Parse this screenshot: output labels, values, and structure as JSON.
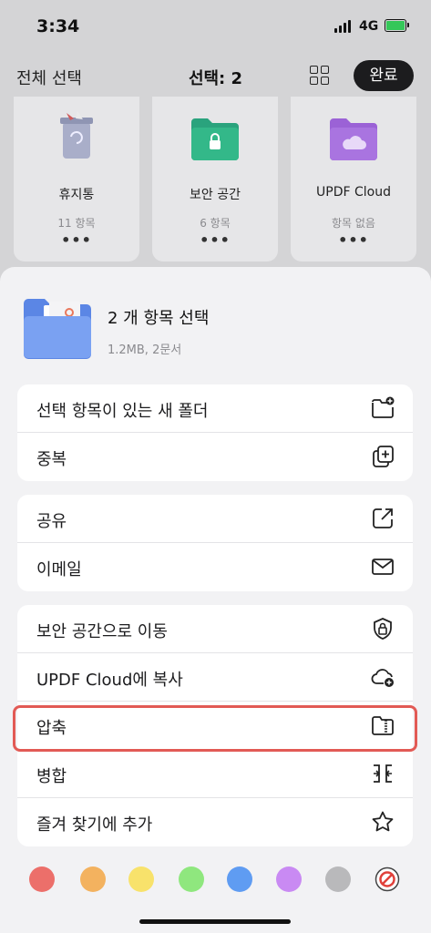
{
  "status": {
    "time": "3:34",
    "network": "4G"
  },
  "nav": {
    "select_all": "전체 선택",
    "title": "선택: 2",
    "done": "완료"
  },
  "cards": [
    {
      "name": "휴지통",
      "count": "11 항목",
      "icon": "trash-icon"
    },
    {
      "name": "보안 공간",
      "count": "6 항목",
      "icon": "secure-folder-icon"
    },
    {
      "name": "UPDF Cloud",
      "count": "항목 없음",
      "icon": "cloud-folder-icon"
    }
  ],
  "sheet": {
    "title": "2 개 항목 선택",
    "subtitle": "1.2MB, 2문서",
    "groups": [
      [
        {
          "label": "선택 항목이 있는 새 폴더",
          "icon": "new-folder-icon"
        },
        {
          "label": "중복",
          "icon": "duplicate-icon"
        }
      ],
      [
        {
          "label": "공유",
          "icon": "share-icon"
        },
        {
          "label": "이메일",
          "icon": "mail-icon"
        }
      ],
      [
        {
          "label": "보안 공간으로 이동",
          "icon": "shield-lock-icon"
        },
        {
          "label": "UPDF Cloud에 복사",
          "icon": "cloud-add-icon"
        },
        {
          "label": "압축",
          "icon": "zip-folder-icon"
        },
        {
          "label": "병합",
          "icon": "merge-icon"
        },
        {
          "label": "즐겨 찾기에 추가",
          "icon": "star-icon"
        }
      ]
    ],
    "colors": [
      "#ec6f6a",
      "#f3b25f",
      "#f8e26b",
      "#8fe77e",
      "#5f9cf2",
      "#c98af3",
      "#b9b9bb"
    ]
  }
}
